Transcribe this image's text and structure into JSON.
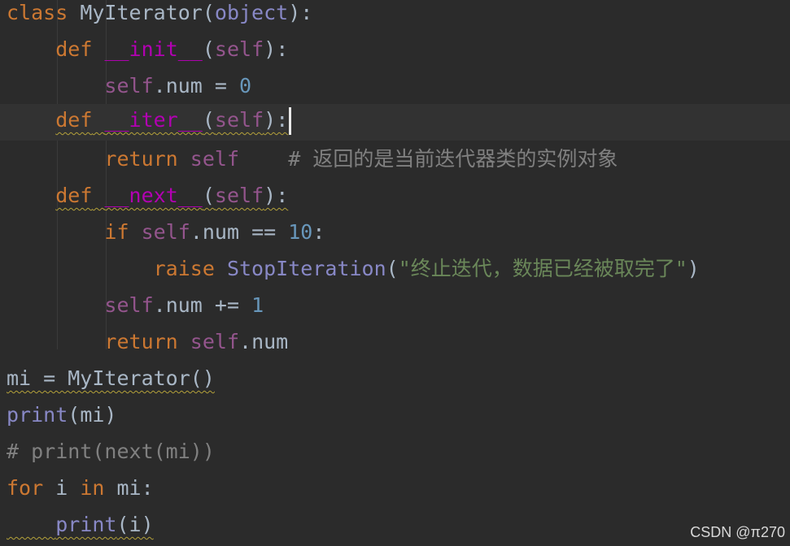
{
  "code": {
    "l1": {
      "kw": "class",
      "name": " MyIterator",
      "open": "(",
      "base": "object",
      "close": "):"
    },
    "l2": {
      "kw": "def",
      "name": "__init__",
      "open": "(",
      "self": "self",
      "close": "):"
    },
    "l3": {
      "self": "self",
      "rest": ".num = ",
      "num": "0"
    },
    "l4": {
      "kw": "def",
      "name": "__iter__",
      "open": "(",
      "self": "self",
      "close": "):"
    },
    "l5": {
      "kw": "return",
      "self": "self",
      "comment": "# 返回的是当前迭代器类的实例对象"
    },
    "l6": {
      "kw": "def",
      "name": "__next__",
      "open": "(",
      "self": "self",
      "close": "):"
    },
    "l7": {
      "kw": "if",
      "self": "self",
      "rest": ".num == ",
      "num": "10",
      "colon": ":"
    },
    "l8": {
      "kw": "raise",
      "cls": "StopIteration",
      "open": "(",
      "str": "\"终止迭代，数据已经被取完了\"",
      "close": ")"
    },
    "l9": {
      "self": "self",
      "rest": ".num += ",
      "num": "1"
    },
    "l10": {
      "kw": "return",
      "self": "self",
      "rest": ".num"
    },
    "l11": {
      "text": "mi = MyIterator()"
    },
    "l12": {
      "fn": "print",
      "rest": "(mi)"
    },
    "l13": {
      "comment": "# print(next(mi))"
    },
    "l14": {
      "kw1": "for",
      "mid": " i ",
      "kw2": "in",
      "rest": " mi:"
    },
    "l15": {
      "fn": "print",
      "rest": "(i)"
    }
  },
  "watermark": "CSDN @π270",
  "colors": {
    "background": "#2b2b2b",
    "keyword": "#cc7832",
    "magic_method": "#b200b2",
    "self": "#94558d",
    "number": "#6897bb",
    "builtin": "#8888c6",
    "string": "#6a8759",
    "comment": "#808080",
    "default": "#a9b7c6"
  }
}
